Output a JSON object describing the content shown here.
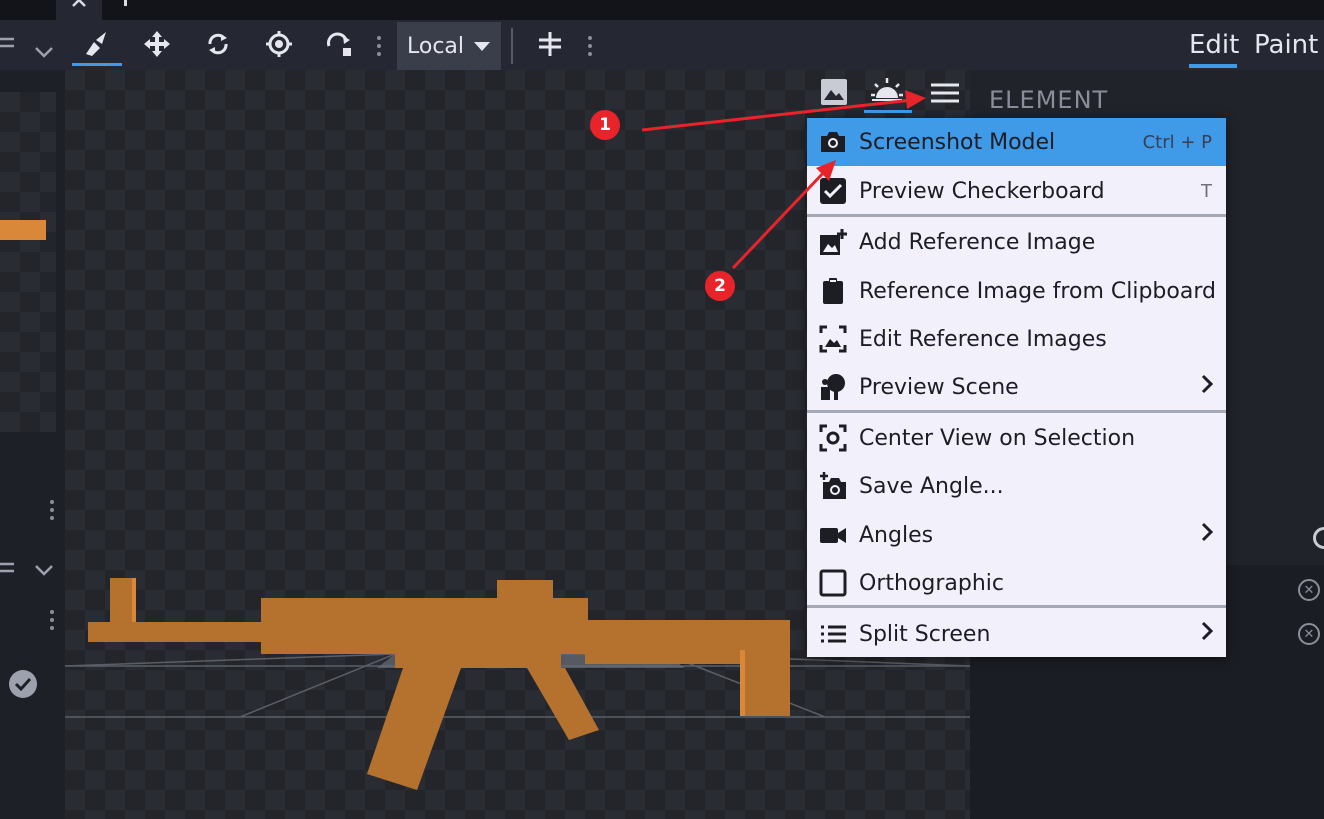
{
  "toolbar": {
    "tools": [
      "pivot-tool",
      "move-tool",
      "rotate-tool",
      "pivot-point-tool",
      "resize-tool"
    ],
    "space_select": "Local"
  },
  "modes": {
    "edit": "Edit",
    "paint": "Paint",
    "active": "Edit"
  },
  "viewport_header": {
    "icons": [
      "background-image-icon",
      "lighting-icon",
      "hamburger-menu-icon"
    ]
  },
  "right_panel": {
    "section_title": "ELEMENT"
  },
  "menu": {
    "items": [
      {
        "label": "Screenshot Model",
        "shortcut": "Ctrl + P",
        "icon": "camera-icon",
        "highlighted": true
      },
      {
        "label": "Preview Checkerboard",
        "shortcut": "T",
        "icon": "checkbox-checked-icon"
      },
      {
        "label": "Add Reference Image",
        "icon": "add-image-icon"
      },
      {
        "label": "Reference Image from Clipboard",
        "icon": "clipboard-icon"
      },
      {
        "label": "Edit Reference Images",
        "icon": "edit-image-icon"
      },
      {
        "label": "Preview Scene",
        "icon": "scene-icon",
        "submenu": true
      },
      {
        "label": "Center View on Selection",
        "icon": "center-focus-icon"
      },
      {
        "label": "Save Angle...",
        "icon": "add-camera-icon"
      },
      {
        "label": "Angles",
        "icon": "video-camera-icon",
        "submenu": true
      },
      {
        "label": "Orthographic",
        "icon": "checkbox-unchecked-icon"
      },
      {
        "label": "Split Screen",
        "icon": "list-icon",
        "submenu": true
      }
    ]
  },
  "annotations": {
    "badge1": "1",
    "badge2": "2"
  },
  "colors": {
    "accent": "#3f9ae8",
    "model": "#b5722e",
    "annotation": "#e8232a"
  }
}
